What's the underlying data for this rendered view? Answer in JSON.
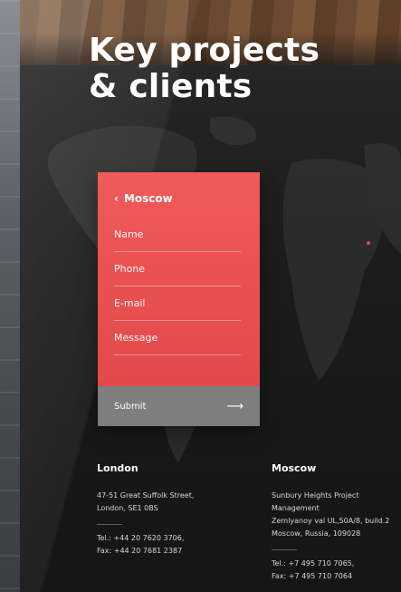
{
  "hero": {
    "title_line1": "Key projects",
    "title_line2": "& clients"
  },
  "form": {
    "city": "Moscow",
    "fields": {
      "name": "Name",
      "phone": "Phone",
      "email": "E-mail",
      "message": "Message"
    },
    "submit_label": "Submit",
    "accent_color": "#ef5656"
  },
  "offices": {
    "london": {
      "name": "London",
      "address": [
        "47-51 Great Suffolk Street,",
        "London, SE1 0BS"
      ],
      "tel": "Tel.: +44 20 7620 3706,",
      "fax": "Fax: +44 20 7681 2387"
    },
    "moscow": {
      "name": "Moscow",
      "address": [
        "Sunbury Heights Project",
        "Management",
        "Zemlyanoy val UL,50A/8, build.2",
        "Moscow, Russia, 109028"
      ],
      "tel": "Tel.: +7 495 710 7065,",
      "fax": "Fax: +7 495 710 7064"
    }
  },
  "icons": {
    "back": "chevron-left-icon",
    "submit_arrow": "arrow-right-icon"
  }
}
